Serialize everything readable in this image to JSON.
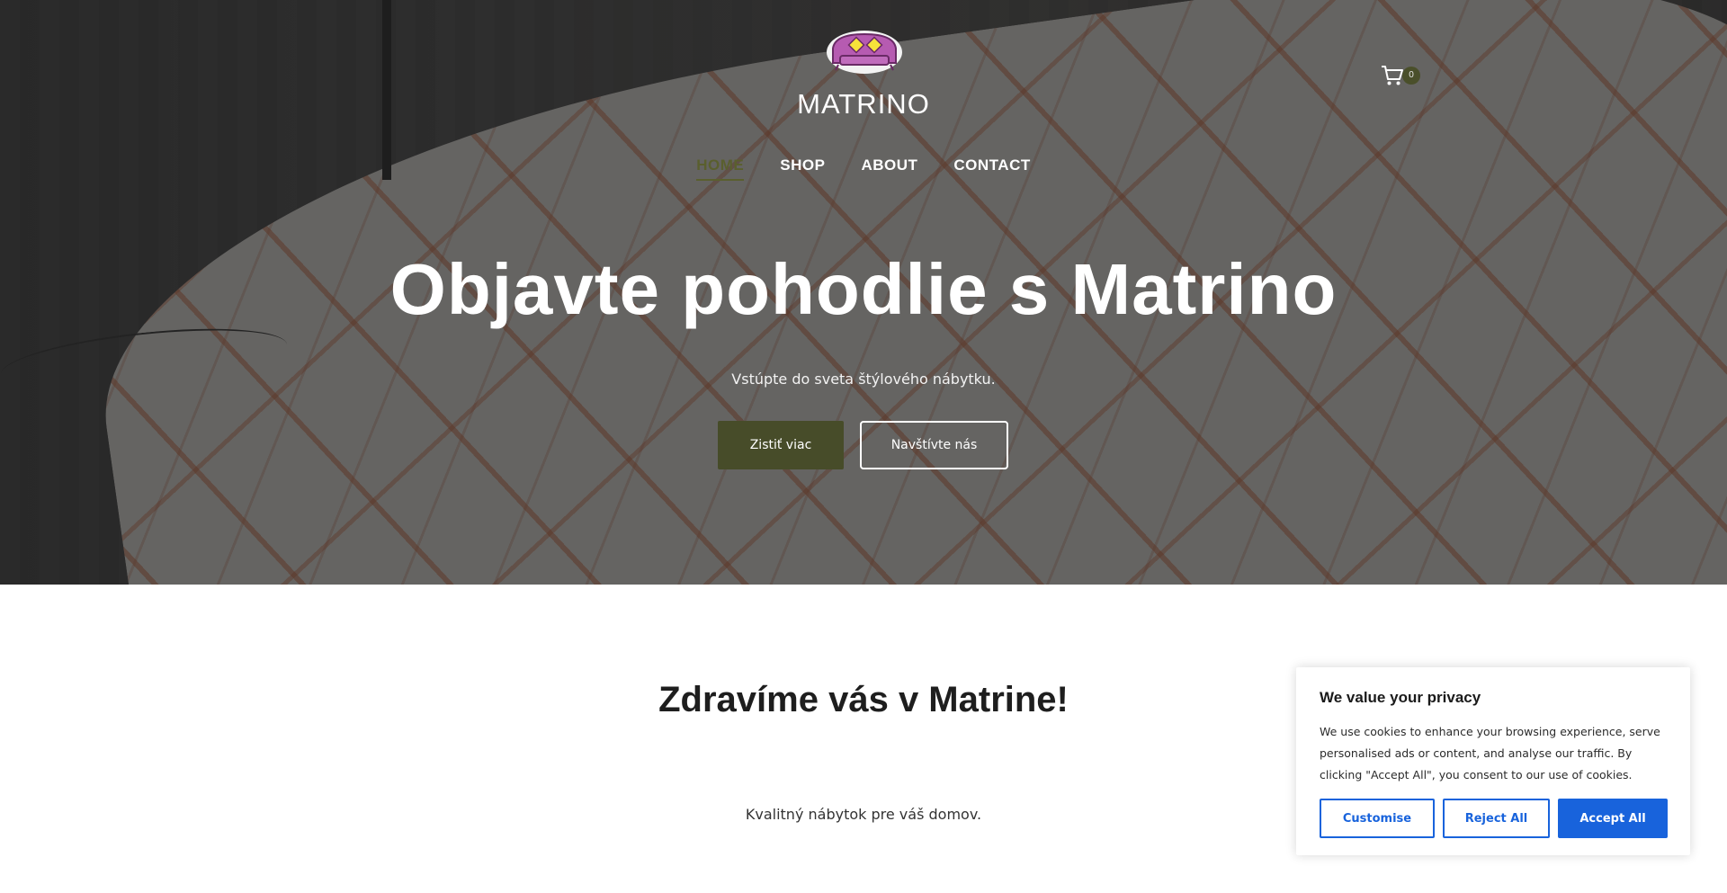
{
  "header": {
    "brand": "MATRINO",
    "cart_count": "0"
  },
  "nav": {
    "items": [
      {
        "label": "HOME",
        "active": true
      },
      {
        "label": "SHOP",
        "active": false
      },
      {
        "label": "ABOUT",
        "active": false
      },
      {
        "label": "CONTACT",
        "active": false
      }
    ]
  },
  "hero": {
    "title": "Objavte pohodlie s Matrino",
    "subtitle": "Vstúpte do sveta štýlového nábytku.",
    "primary_button": "Zistiť viac",
    "secondary_button": "Navštívte nás"
  },
  "intro": {
    "heading": "Zdravíme vás v Matrine!",
    "tagline": "Kvalitný nábytok pre váš domov."
  },
  "cookie_banner": {
    "title": "We value your privacy",
    "text": "We use cookies to enhance your browsing experience, serve personalised ads or content, and analyse our traffic. By clicking \"Accept All\", you consent to our use of cookies.",
    "customise_label": "Customise",
    "reject_label": "Reject All",
    "accept_label": "Accept All"
  },
  "colors": {
    "accent": "#474c29",
    "cookie_blue": "#1863dc"
  },
  "icons": {
    "logo": "sofa-logo-icon",
    "cart": "cart-icon"
  }
}
